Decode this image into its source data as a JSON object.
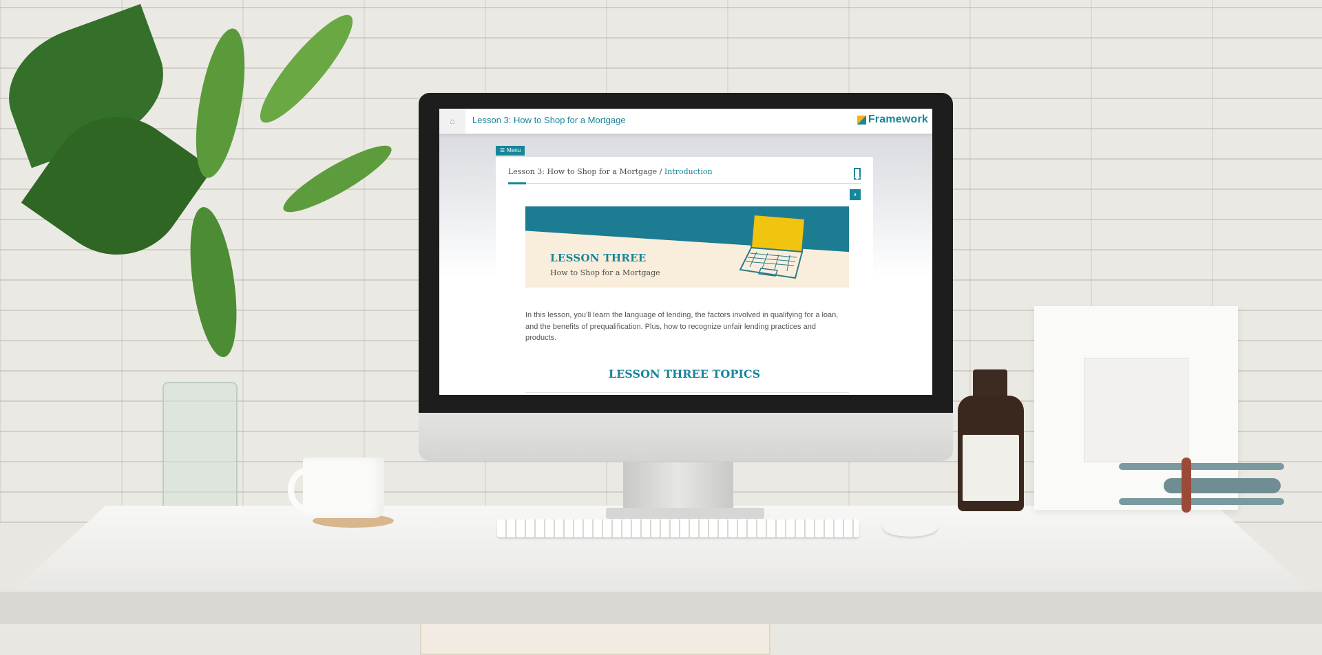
{
  "screen": {
    "course_title": "Lesson 3: How to Shop for a Mortgage",
    "brand_name": "Framework",
    "menu_label": "Menu",
    "breadcrumb": {
      "lesson": "Lesson 3: How to Shop for a Mortgage",
      "separator": "/",
      "current": "Introduction"
    },
    "banner": {
      "title": "LESSON THREE",
      "subtitle": "How to Shop for a Mortgage"
    },
    "intro_text": "In this lesson, you’ll learn the language of lending, the factors involved in qualifying for a loan, and the benefits of prequalification. Plus, how to recognize unfair lending practices and products.",
    "topics_heading": "LESSON THREE TOPICS",
    "section_progress": 0.05
  },
  "icons": {
    "home": "home-icon",
    "menu": "hamburger-icon",
    "bookmark": "bookmark-icon",
    "next": "chevron-right-icon",
    "brand": "framework-logo-icon"
  },
  "colors": {
    "accent": "#17859a",
    "brand_yellow": "#f1b31c",
    "banner_background": "#f9eedb"
  }
}
